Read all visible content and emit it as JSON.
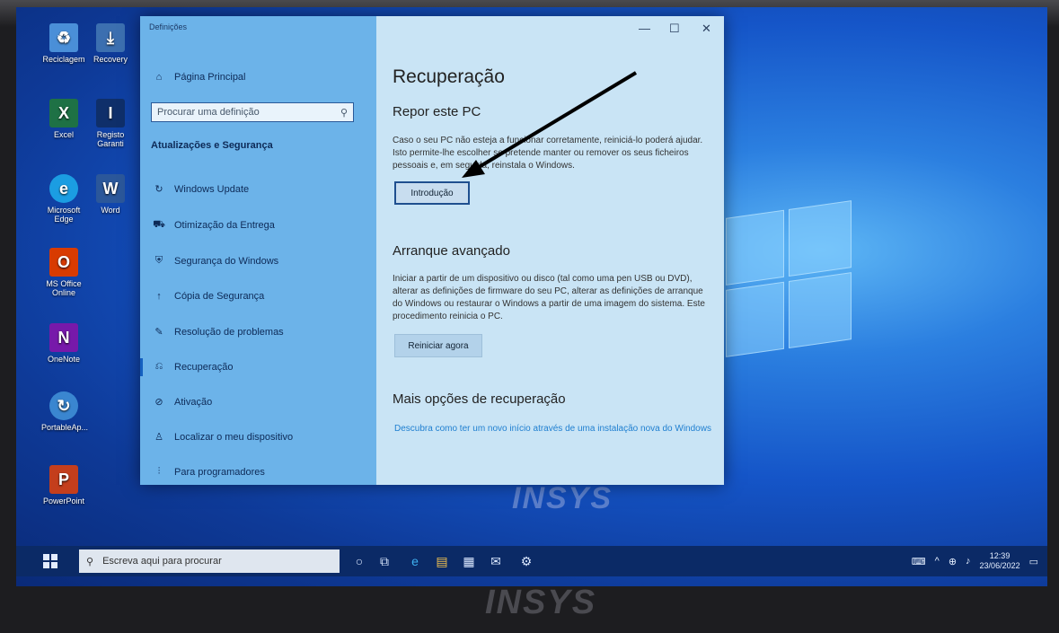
{
  "window": {
    "title": "Definições",
    "controls": [
      "—",
      "☐",
      "✕"
    ]
  },
  "sidebar": {
    "home_label": "Página Principal",
    "search_placeholder": "Procurar uma definição",
    "section_title": "Atualizações e Segurança",
    "items": [
      {
        "label": "Windows Update",
        "icon": "refresh-icon"
      },
      {
        "label": "Otimização da Entrega",
        "icon": "delivery-icon"
      },
      {
        "label": "Segurança do Windows",
        "icon": "shield-icon"
      },
      {
        "label": "Cópia de Segurança",
        "icon": "backup-icon"
      },
      {
        "label": "Resolução de problemas",
        "icon": "wrench-icon"
      },
      {
        "label": "Recuperação",
        "icon": "recovery-icon"
      },
      {
        "label": "Ativação",
        "icon": "check-circle-icon"
      },
      {
        "label": "Localizar o meu dispositivo",
        "icon": "person-location-icon"
      },
      {
        "label": "Para programadores",
        "icon": "developer-icon"
      }
    ],
    "active_item": "Recuperação"
  },
  "main": {
    "page_title": "Recuperação",
    "reset": {
      "heading": "Repor este PC",
      "description": "Caso o seu PC não esteja a funcionar corretamente, reiniciá-lo poderá ajudar. Isto permite-lhe escolher se pretende manter ou remover os seus ficheiros pessoais e, em seguida, reinstala o Windows.",
      "button": "Introdução"
    },
    "advanced": {
      "heading": "Arranque avançado",
      "description": "Iniciar a partir de um dispositivo ou disco (tal como uma pen USB ou DVD), alterar as definições de firmware do seu PC, alterar as definições de arranque do Windows ou restaurar o Windows a partir de uma imagem do sistema. Este procedimento reinicia o PC.",
      "button": "Reiniciar agora"
    },
    "more": {
      "heading": "Mais opções de recuperação",
      "link": "Descubra como ter um novo início através de uma instalação nova do Windows"
    }
  },
  "desktop": {
    "icons": [
      {
        "label": "Reciclagem",
        "icon": "recycle-bin-icon",
        "color": "#4a8fd8",
        "glyph": "♻"
      },
      {
        "label": "Recovery",
        "icon": "recovery-app-icon",
        "color": "#3c6fb0",
        "glyph": "⤓"
      },
      {
        "label": "Excel",
        "icon": "excel-icon",
        "color": "#1e7145",
        "glyph": "X"
      },
      {
        "label": "Registo Garanti",
        "icon": "insys-icon",
        "color": "#0f2f6a",
        "glyph": "I"
      },
      {
        "label": "Microsoft Edge",
        "icon": "edge-icon",
        "color": "#1b9de2",
        "glyph": "e"
      },
      {
        "label": "Word",
        "icon": "word-icon",
        "color": "#2b579a",
        "glyph": "W"
      },
      {
        "label": "MS Office Online",
        "icon": "office-icon",
        "color": "#d83b01",
        "glyph": "O"
      },
      {
        "label": "OneNote",
        "icon": "onenote-icon",
        "color": "#7719aa",
        "glyph": "N"
      },
      {
        "label": "PortableAp...",
        "icon": "portableapps-icon",
        "color": "#3a86d0",
        "glyph": "↻"
      },
      {
        "label": "PowerPoint",
        "icon": "powerpoint-icon",
        "color": "#c43e1c",
        "glyph": "P"
      }
    ],
    "wallpaper_brand": "INSYS"
  },
  "taskbar": {
    "search_placeholder": "Escreva aqui para procurar",
    "time": "12:39",
    "date": "23/06/2022"
  },
  "monitor_brand": "INSYS",
  "colors": {
    "accent": "#1560c0",
    "sidebar": "#46a0e6",
    "taskbar": "#0b2a66",
    "link": "#1f7fd0"
  }
}
